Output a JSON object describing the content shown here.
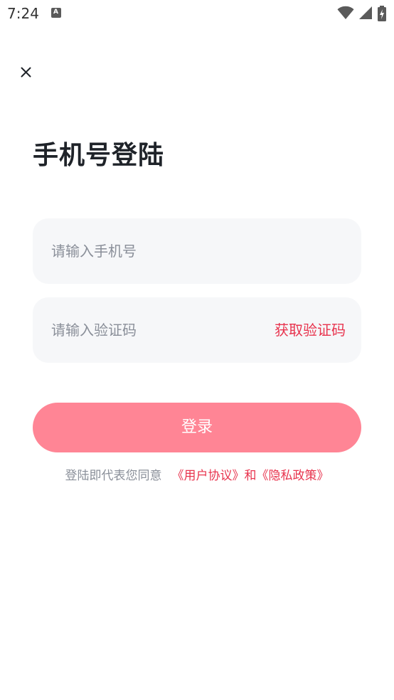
{
  "status_bar": {
    "time": "7:24",
    "notification_letter": "A",
    "icons": [
      "notification-a-icon",
      "wifi-icon",
      "signal-icon",
      "battery-charging-icon"
    ]
  },
  "header": {
    "close_icon": "close-icon"
  },
  "title": "手机号登陆",
  "phone_field": {
    "placeholder": "请输入手机号",
    "value": ""
  },
  "code_field": {
    "placeholder": "请输入验证码",
    "value": "",
    "get_code_label": "获取验证码"
  },
  "login_button": {
    "label": "登录"
  },
  "agreement": {
    "prefix": "登陆即代表您同意",
    "user_agreement": "《用户协议》",
    "and": "和",
    "privacy_policy": "《隐私政策》"
  },
  "colors": {
    "accent": "#e8344e",
    "button": "#ff8595",
    "field_bg": "#f6f7f9",
    "placeholder": "#8a8f99",
    "title": "#1f2329"
  }
}
